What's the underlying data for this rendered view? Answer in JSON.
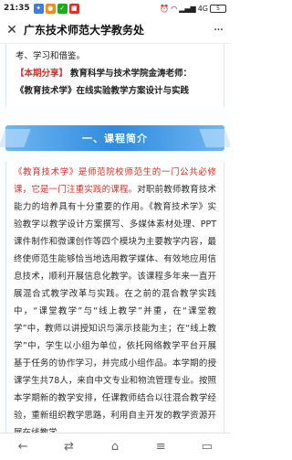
{
  "status_bar": {
    "time": "21:35",
    "badges": [
      {
        "icon": "app-badge-blue-icon",
        "color": "#3b7de0"
      },
      {
        "icon": "app-badge-orange-icon",
        "color": "#f08a24"
      },
      {
        "icon": "app-badge-green-icon",
        "color": "#1aad19"
      },
      {
        "icon": "app-badge-red-icon",
        "color": "#e02e24"
      }
    ],
    "network": "4G",
    "battery": "5"
  },
  "header": {
    "close_icon": "close-icon",
    "title": "广东技术师范大学教务处",
    "more_icon": "more-icon"
  },
  "article": {
    "intro_line": "考、学习和借鉴。",
    "share_tag": "【本期分享】",
    "share_text_1": "教育科学与技术学院金涛老师：",
    "share_text_2": "《教育技术学》在线实验教学方案设计与实践",
    "section_title": "一、课程简介",
    "para_red": "《教育技术学》是师范院校师范生的一门公共必修课，它是一门注重实践的课程。",
    "para_rest": "对职前教师教育技术能力的培养具有十分重要的作用。《教育技术学》实验教学以教学设计方案撰写、多媒体素材处理、PPT课件制作和微课创作等四个模块为主要教学内容，最终使师范生能够恰当地选用教学媒体、有效地应用信息技术，顺利开展信息化教学。该课程多年来一直开展混合式教学改革与实践。在之前的混合教学实践中，“课堂教学”与“线上教学”并重，在“课堂教学”中，教师以讲授知识与演示技能为主；在“线上教学”中，学生以小组为单位，依托网络教学平台开展基于任务的协作学习，并完成小组作品。本学期的授课学生共78人，来自中文专业和物流管理专业。按照本学期新的教学安排，任课教师结合以往混合教学经验，重新组织教学思路，利用自主开发的教学资源开展在线教学。"
  },
  "bottom_nav": {
    "back_icon": "back-icon",
    "forward_icon": "forward-icon",
    "home_icon": "home-icon",
    "menu_icon": "menu-icon",
    "tabs_icon": "tabs-icon"
  }
}
